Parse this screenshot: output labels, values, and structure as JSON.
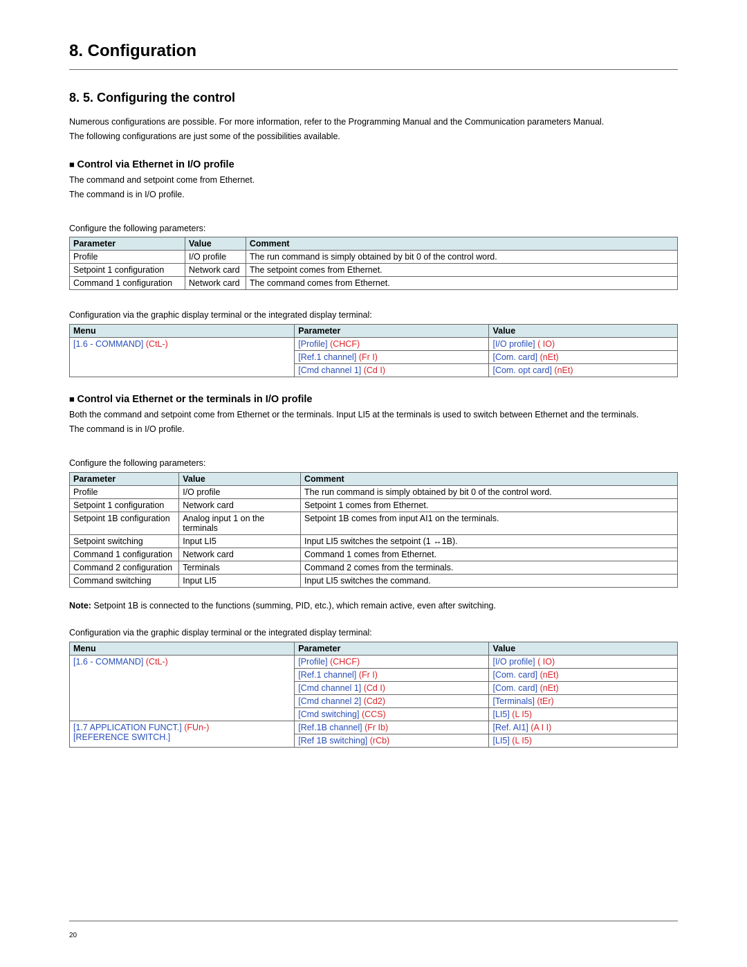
{
  "chapter": "8. Configuration",
  "section": "8. 5. Configuring the control",
  "intro": {
    "p1": "Numerous configurations are possible. For more information, refer to the Programming Manual and the Communication parameters Manual.",
    "p2": "The following configurations are just some of the possibilities available."
  },
  "block1": {
    "heading": "Control via Ethernet in I/O profile",
    "p1": "The command and setpoint come from Ethernet.",
    "p2": "The command is in I/O profile.",
    "p3": "Configure the following parameters:",
    "table_params": {
      "headers": {
        "c1": "Parameter",
        "c2": "Value",
        "c3": "Comment"
      },
      "rows": [
        {
          "c1": "Profile",
          "c2": "I/O profile",
          "c3": "The run command is simply obtained by bit 0 of the control word."
        },
        {
          "c1": "Setpoint 1 configuration",
          "c2": "Network card",
          "c3": "The setpoint comes from Ethernet."
        },
        {
          "c1": "Command 1 configuration",
          "c2": "Network card",
          "c3": "The command comes from Ethernet."
        }
      ]
    },
    "p4": "Configuration via the graphic display terminal or the integrated display terminal:",
    "table_menu": {
      "headers": {
        "c1": "Menu",
        "c2": "Parameter",
        "c3": "Value"
      },
      "rows": [
        {
          "menu_b": "[1.6 - COMMAND]",
          "menu_r": "(CtL-)",
          "param_b": "[Profile]",
          "param_r": "(CHCF)",
          "val_b": "[I/O profile]",
          "val_r": "( IO)"
        },
        {
          "menu_b": "",
          "menu_r": "",
          "param_b": "[Ref.1 channel]",
          "param_r": "(Fr I)",
          "val_b": "[Com. card]",
          "val_r": "(nEt)"
        },
        {
          "menu_b": "",
          "menu_r": "",
          "param_b": "[Cmd channel 1]",
          "param_r": "(Cd I)",
          "val_b": "[Com. opt card]",
          "val_r": "(nEt)"
        }
      ]
    }
  },
  "block2": {
    "heading": "Control via Ethernet or the terminals in I/O profile",
    "p1": "Both the command and setpoint come from Ethernet or the terminals. Input LI5 at the terminals is used to switch between Ethernet and the terminals.",
    "p2": "The command is in I/O profile.",
    "p3": "Configure the following parameters:",
    "table_params": {
      "headers": {
        "c1": "Parameter",
        "c2": "Value",
        "c3": "Comment"
      },
      "rows": [
        {
          "c1": "Profile",
          "c2": "I/O profile",
          "c3": "The run command is simply obtained by bit 0 of the control word."
        },
        {
          "c1": "Setpoint 1 configuration",
          "c2": "Network card",
          "c3": "Setpoint 1 comes from Ethernet."
        },
        {
          "c1": "Setpoint 1B configuration",
          "c2": "Analog input 1 on the terminals",
          "c3": "Setpoint 1B comes from input AI1 on the terminals."
        },
        {
          "c1": "Setpoint switching",
          "c2": "Input LI5",
          "c3": "Input LI5 switches the setpoint (1 ↔1B)."
        },
        {
          "c1": "Command 1 configuration",
          "c2": "Network card",
          "c3": "Command 1 comes from Ethernet."
        },
        {
          "c1": "Command 2 configuration",
          "c2": "Terminals",
          "c3": "Command 2 comes from the terminals."
        },
        {
          "c1": "Command switching",
          "c2": "Input LI5",
          "c3": "Input LI5 switches the command."
        }
      ]
    },
    "note_label": "Note:",
    "note_text": " Setpoint 1B is connected to the functions (summing, PID, etc.), which remain active, even after switching.",
    "p4": "Configuration via the graphic display terminal or the integrated display terminal:",
    "table_menu": {
      "headers": {
        "c1": "Menu",
        "c2": "Parameter",
        "c3": "Value"
      },
      "rows": [
        {
          "menu_b": "[1.6 - COMMAND]",
          "menu_r": "(CtL-)",
          "param_b": "[Profile]",
          "param_r": "(CHCF)",
          "val_b": "[I/O profile]",
          "val_r": "( IO)"
        },
        {
          "menu_b": "",
          "menu_r": "",
          "param_b": "[Ref.1 channel]",
          "param_r": "(Fr I)",
          "val_b": "[Com. card]",
          "val_r": "(nEt)"
        },
        {
          "menu_b": "",
          "menu_r": "",
          "param_b": "[Cmd channel 1]",
          "param_r": "(Cd I)",
          "val_b": "[Com. card]",
          "val_r": "(nEt)"
        },
        {
          "menu_b": "",
          "menu_r": "",
          "param_b": "[Cmd channel 2]",
          "param_r": "(Cd2)",
          "val_b": "[Terminals]",
          "val_r": "(tEr)"
        },
        {
          "menu_b": "",
          "menu_r": "",
          "param_b": "[Cmd switching]",
          "param_r": "(CCS)",
          "val_b": "[LI5]",
          "val_r": "(L I5)"
        },
        {
          "menu_b": "[1.7 APPLICATION FUNCT.]",
          "menu_r": "(FUn-)",
          "menu_b2": "[REFERENCE SWITCH.]",
          "param_b": "[Ref.1B channel]",
          "param_r": "(Fr Ib)",
          "val_b": "[Ref. AI1]",
          "val_r": "(A I I)"
        },
        {
          "menu_b": "",
          "menu_r": "",
          "param_b": "[Ref 1B switching]",
          "param_r": "(rCb)",
          "val_b": "[LI5]",
          "val_r": "(L I5)"
        }
      ]
    }
  },
  "page_number": "20"
}
